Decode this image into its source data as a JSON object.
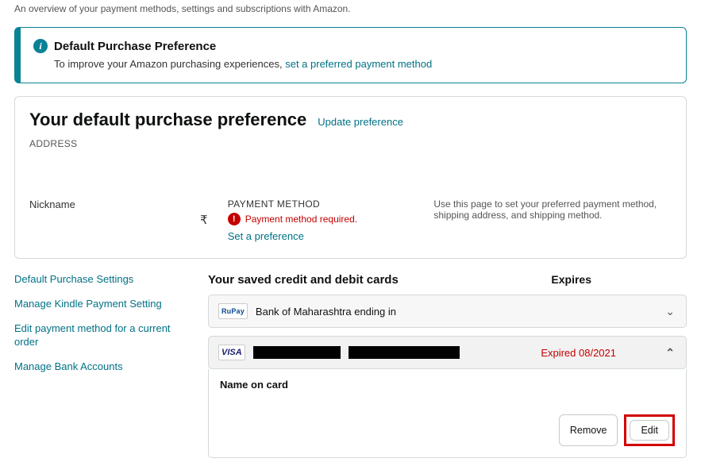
{
  "header": {
    "subtitle": "An overview of your payment methods, settings and subscriptions with Amazon."
  },
  "alert": {
    "title": "Default Purchase Preference",
    "body_pre": "To improve your Amazon purchasing experiences, ",
    "link": "set a preferred payment method"
  },
  "pref_panel": {
    "title": "Your default purchase preference",
    "update_link": "Update preference",
    "address_label": "ADDRESS",
    "nickname_label": "Nickname",
    "currency_symbol": "₹",
    "pm_label": "PAYMENT METHOD",
    "pm_warning": "Payment method required.",
    "set_link": "Set a preference",
    "helper": "Use this page to set your preferred payment method, shipping address, and shipping method."
  },
  "sidebar": {
    "items": [
      "Default Purchase Settings",
      "Manage Kindle Payment Setting",
      "Edit payment method for a current order",
      "Manage Bank Accounts"
    ]
  },
  "cards": {
    "heading": "Your saved credit and debit cards",
    "expires_label": "Expires",
    "rows": [
      {
        "brand": "RuPay",
        "text": "Bank of Maharashtra  ending in",
        "expired": ""
      },
      {
        "brand": "VISA",
        "expired": "Expired  08/2021"
      }
    ],
    "detail": {
      "name_label": "Name on card",
      "remove": "Remove",
      "edit": "Edit"
    }
  }
}
